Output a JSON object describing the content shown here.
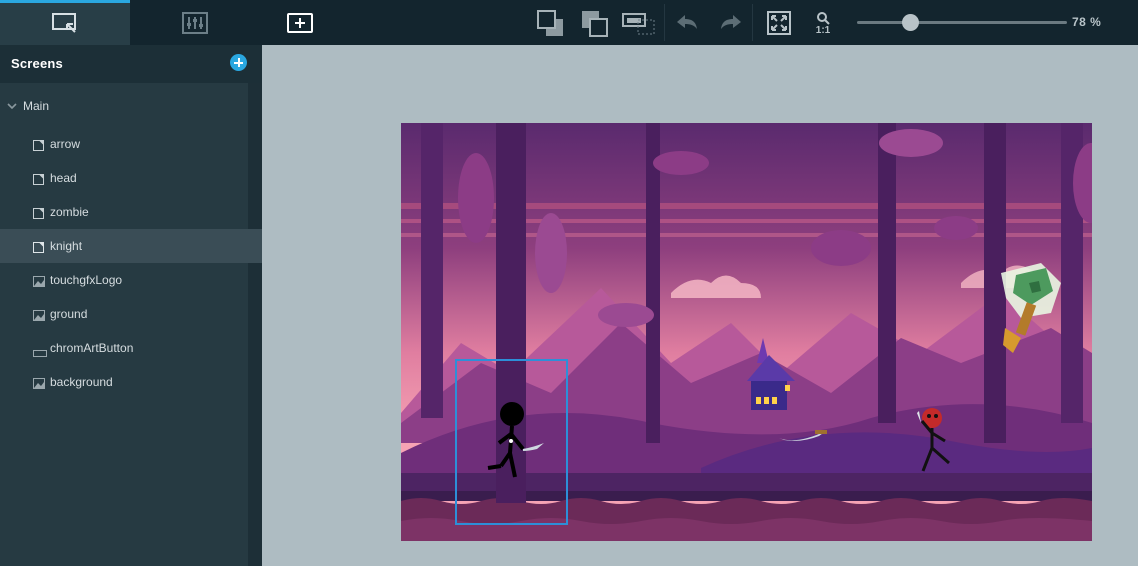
{
  "toolbar": {
    "tabs": [
      {
        "name": "tab-canvas",
        "active": true
      },
      {
        "name": "tab-properties",
        "active": false
      },
      {
        "name": "tab-add-widget",
        "active": false
      }
    ],
    "zoom": {
      "percent": 78,
      "label": "78 %",
      "fit_label": "1:1"
    }
  },
  "sidebar": {
    "title": "Screens",
    "group": "Main",
    "items": [
      {
        "label": "arrow",
        "icon": "page-icon"
      },
      {
        "label": "head",
        "icon": "page-icon"
      },
      {
        "label": "zombie",
        "icon": "page-icon"
      },
      {
        "label": "knight",
        "icon": "page-icon",
        "selected": true
      },
      {
        "label": "touchgfxLogo",
        "icon": "image-icon"
      },
      {
        "label": "ground",
        "icon": "image-icon"
      },
      {
        "label": "chromArtButton",
        "icon": "button-icon"
      },
      {
        "label": "background",
        "icon": "image-icon"
      }
    ]
  },
  "colors": {
    "accent": "#2aa7e0",
    "toolbar_bg": "#13252e",
    "panel_bg": "#263a42",
    "canvas_bg": "#aebcc2",
    "selection": "#2d8fd8"
  }
}
